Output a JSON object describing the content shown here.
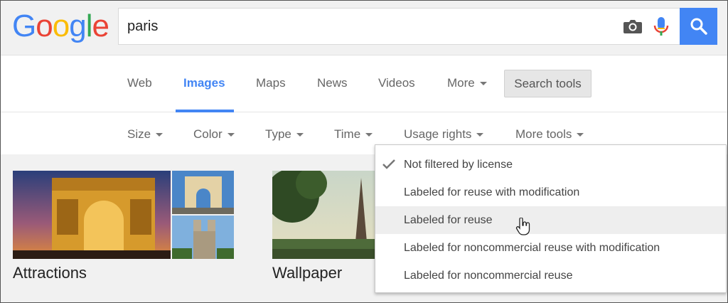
{
  "header": {
    "logo_letters": [
      {
        "ch": "G",
        "color": "#4285f4"
      },
      {
        "ch": "o",
        "color": "#ea4335"
      },
      {
        "ch": "o",
        "color": "#fbbc05"
      },
      {
        "ch": "g",
        "color": "#4285f4"
      },
      {
        "ch": "l",
        "color": "#34a853"
      },
      {
        "ch": "e",
        "color": "#ea4335"
      }
    ],
    "search_value": "paris",
    "accent": "#4285f4"
  },
  "tabs": {
    "web": "Web",
    "images": "Images",
    "maps": "Maps",
    "news": "News",
    "videos": "Videos",
    "more": "More",
    "search_tools": "Search tools"
  },
  "tools": {
    "size": "Size",
    "color": "Color",
    "type": "Type",
    "time": "Time",
    "usage_rights": "Usage rights",
    "more_tools": "More tools"
  },
  "results": {
    "attractions": "Attractions",
    "wallpaper": "Wallpaper"
  },
  "dropdown": {
    "items": [
      "Not filtered by license",
      "Labeled for reuse with modification",
      "Labeled for reuse",
      "Labeled for noncommercial reuse with modification",
      "Labeled for noncommercial reuse"
    ],
    "selected_index": 0,
    "hover_index": 2
  }
}
